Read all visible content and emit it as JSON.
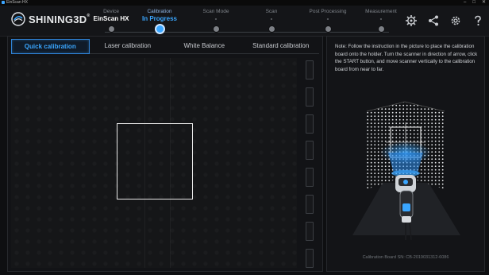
{
  "window": {
    "title": "EinScan HX"
  },
  "brand": {
    "name": "SHINING3D",
    "mark": "®"
  },
  "steps": [
    {
      "label": "Device",
      "value": "EinScan HX",
      "state": "done"
    },
    {
      "label": "Calibration",
      "value": "In Progress",
      "state": "active"
    },
    {
      "label": "Scan Mode",
      "value": "-",
      "state": "pending"
    },
    {
      "label": "Scan",
      "value": "-",
      "state": "pending"
    },
    {
      "label": "Post Processing",
      "value": "-",
      "state": "pending"
    },
    {
      "label": "Measurement",
      "value": "-",
      "state": "pending"
    }
  ],
  "header_icons": [
    "settings-gear-icon",
    "share-icon",
    "gear-icon",
    "help-icon"
  ],
  "tabs": [
    {
      "label": "Quick calibration",
      "active": true
    },
    {
      "label": "Laser calibration",
      "active": false
    },
    {
      "label": "White Balance",
      "active": false
    },
    {
      "label": "Standard calibration",
      "active": false
    }
  ],
  "instructions": {
    "note": "Note: Follow the instruction in the picture to place the calibration board onto the holder. Turn the scanner in direction of arrow, click the START button, and move scanner vertically to the calibration board from near to far."
  },
  "calibration_code": "Calibration Board SN: CB-2019031312-6086",
  "colors": {
    "accent": "#3aa6ff",
    "background": "#0e0f11",
    "panel": "#131417"
  }
}
